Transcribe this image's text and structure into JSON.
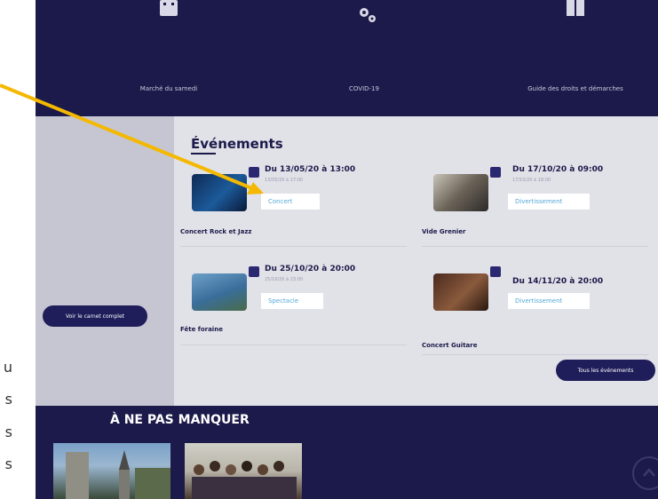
{
  "quick_access": [
    {
      "label": "Marché du samedi",
      "icon": "calendar-icon"
    },
    {
      "label": "COVID-19",
      "icon": "gears-icon"
    },
    {
      "label": "Guide des droits et démarches",
      "icon": "book-icon"
    }
  ],
  "events": {
    "title": "Événements",
    "items": [
      {
        "date": "Du 13/05/20 à 13:00",
        "sub": "13/05/20 à 17:00",
        "tag": "Concert",
        "name": "Concert Rock et Jazz"
      },
      {
        "date": "Du 17/10/20 à 09:00",
        "sub": "17/10/20 à 18:00",
        "tag": "Divertissement",
        "name": "Vide Grenier"
      },
      {
        "date": "Du 25/10/20 à 20:00",
        "sub": "25/10/20 à 23:00",
        "tag": "Spectacle",
        "name": "Fête foraine"
      },
      {
        "date": "Du 14/11/20 à 20:00",
        "sub": "",
        "tag": "Divertissement",
        "name": "Concert Guitare"
      }
    ],
    "all_button": "Tous les événements"
  },
  "sidebar": {
    "carnet_button": "Voir le carnet complet"
  },
  "a_ne_pas_manquer": {
    "title": "À NE PAS MANQUER"
  },
  "edge_letters": [
    "u",
    "s",
    "s",
    "s"
  ],
  "colors": {
    "navy": "#1b1a4a",
    "tag_text": "#55a8d8",
    "arrow": "#f5b800"
  }
}
